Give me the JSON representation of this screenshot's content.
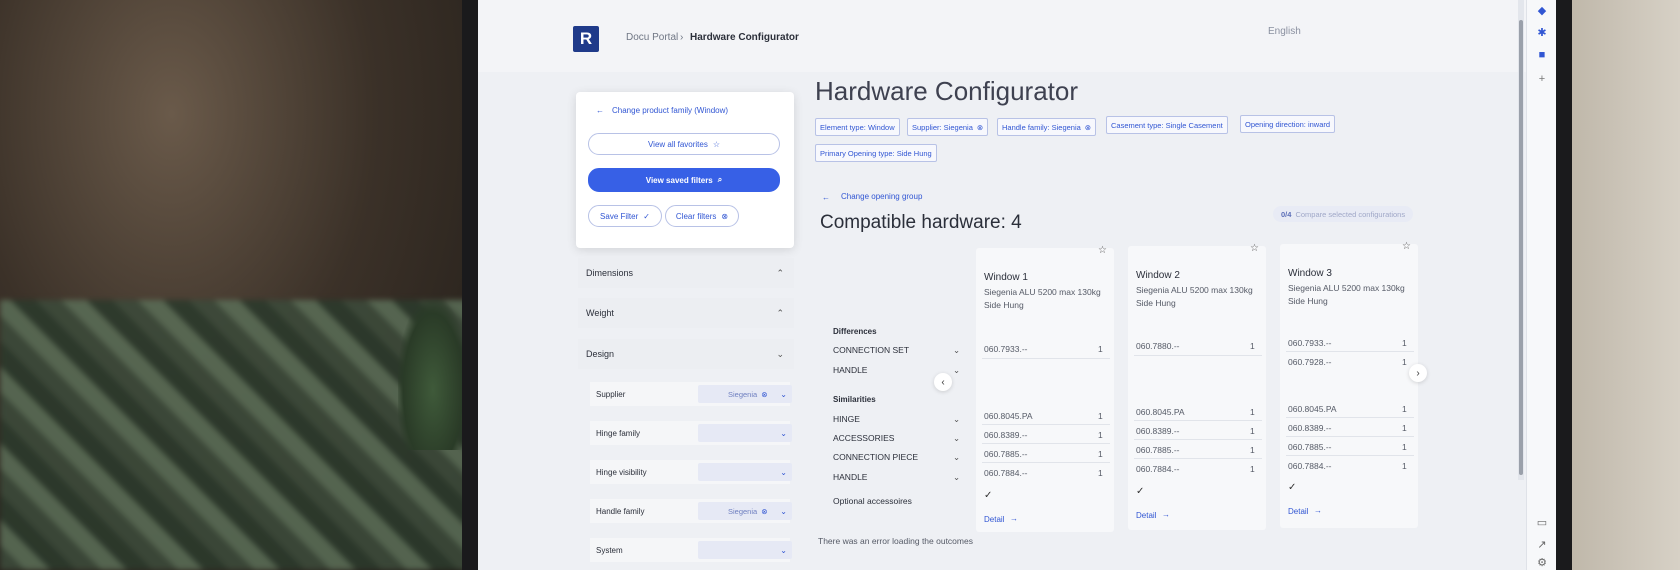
{
  "header": {
    "logo": "R",
    "breadcrumb_root": "Docu Portal",
    "breadcrumb_current": "Hardware Configurator",
    "language": "English"
  },
  "sidebar": {
    "back_link": "Change product family (Window)",
    "view_favorites": "View all favorites",
    "view_saved_filters": "View saved filters",
    "save_filter": "Save Filter",
    "clear_filters": "Clear filters",
    "sections": [
      {
        "label": "Dimensions"
      },
      {
        "label": "Weight"
      },
      {
        "label": "Design"
      }
    ],
    "design_filters": [
      {
        "label": "Supplier",
        "value": "Siegenia"
      },
      {
        "label": "Hinge family",
        "value": ""
      },
      {
        "label": "Hinge visibility",
        "value": ""
      },
      {
        "label": "Handle family",
        "value": "Siegenia"
      },
      {
        "label": "System",
        "value": ""
      }
    ]
  },
  "main": {
    "title": "Hardware Configurator",
    "tags": [
      {
        "text": "Element type: Window",
        "removable": false
      },
      {
        "text": "Supplier: Siegenia",
        "removable": true
      },
      {
        "text": "Handle family: Siegenia",
        "removable": true
      },
      {
        "text": "Casement type: Single Casement",
        "removable": false
      },
      {
        "text": "Opening direction: inward",
        "removable": false
      },
      {
        "text": "Primary Opening type: Side Hung",
        "removable": false
      }
    ],
    "change_group": "Change opening group",
    "compatible_title": "Compatible hardware: 4",
    "compare_count": "0/4",
    "compare_label": "Compare selected configurations",
    "differences_label": "Differences",
    "similarities_label": "Similarities",
    "diff_rows": [
      "CONNECTION SET",
      "HANDLE"
    ],
    "sim_rows": [
      "HINGE",
      "ACCESSORIES",
      "CONNECTION PIECE",
      "HANDLE"
    ],
    "optional_label": "Optional accessoires",
    "error_text": "There was an error loading the outcomes",
    "detail_label": "Detail",
    "windows": [
      {
        "title": "Window 1",
        "line1": "Siegenia ALU 5200 max 130kg",
        "line2": "Side Hung",
        "diff": [
          {
            "code": "060.7933.--",
            "qty": "1"
          },
          {
            "code": "",
            "qty": ""
          }
        ],
        "sim": [
          {
            "code": "060.8045.PA",
            "qty": "1"
          },
          {
            "code": "060.8389.--",
            "qty": "1"
          },
          {
            "code": "060.7885.--",
            "qty": "1"
          },
          {
            "code": "060.7884.--",
            "qty": "1"
          }
        ]
      },
      {
        "title": "Window 2",
        "line1": "Siegenia ALU 5200 max 130kg",
        "line2": "Side Hung",
        "diff": [
          {
            "code": "060.7880.--",
            "qty": "1"
          },
          {
            "code": "",
            "qty": ""
          }
        ],
        "sim": [
          {
            "code": "060.8045.PA",
            "qty": "1"
          },
          {
            "code": "060.8389.--",
            "qty": "1"
          },
          {
            "code": "060.7885.--",
            "qty": "1"
          },
          {
            "code": "060.7884.--",
            "qty": "1"
          }
        ]
      },
      {
        "title": "Window 3",
        "line1": "Siegenia ALU 5200 max 130kg",
        "line2": "Side Hung",
        "diff": [
          {
            "code": "060.7933.--",
            "qty": "1"
          },
          {
            "code": "060.7928.--",
            "qty": "1"
          }
        ],
        "sim": [
          {
            "code": "060.8045.PA",
            "qty": "1"
          },
          {
            "code": "060.8389.--",
            "qty": "1"
          },
          {
            "code": "060.7885.--",
            "qty": "1"
          },
          {
            "code": "060.7884.--",
            "qty": "1"
          }
        ]
      }
    ]
  },
  "colors": {
    "accent": "#3156d3",
    "primary_button": "#3760e6",
    "screen_bg": "#eef0f4"
  }
}
